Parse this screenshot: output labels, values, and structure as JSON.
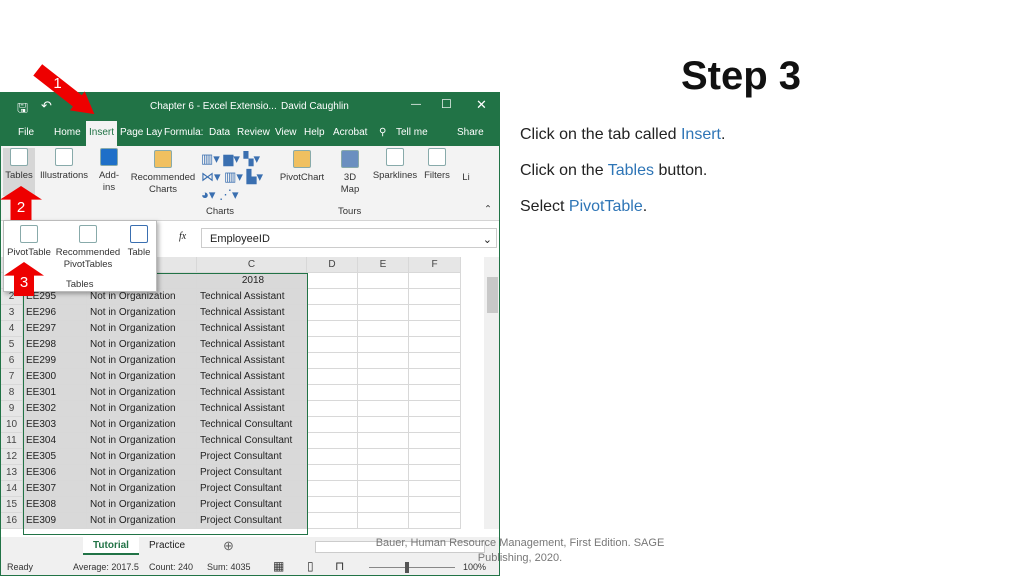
{
  "slide": {
    "title": "Step 3",
    "instructions": [
      {
        "pre": "Click on the tab called ",
        "hl": "Insert",
        "post": "."
      },
      {
        "pre": "Click on the ",
        "hl": "Tables",
        "post": " button."
      },
      {
        "pre": "Select ",
        "hl": "PivotTable",
        "post": "."
      }
    ],
    "citation": "Bauer, Human Resource Management, First Edition. SAGE Publishing, 2020.",
    "step_markers": [
      "1",
      "2",
      "3"
    ]
  },
  "excel": {
    "title": "Chapter 6 - Excel Extensio...",
    "user": "David Caughlin",
    "tabs": [
      "File",
      "Home",
      "Insert",
      "Page Lay",
      "Formula:",
      "Data",
      "Review",
      "View",
      "Help",
      "Acrobat",
      "Tell me",
      "Share"
    ],
    "ribbon": {
      "tables": "Tables",
      "illustrations": "Illustrations",
      "addins": "Add-\nins",
      "recommended_charts": "Recommended Charts",
      "pivotchart": "PivotChart",
      "map3d": "3D Map",
      "sparklines": "Sparklines",
      "filters": "Filters",
      "links": "Li",
      "group_charts": "Charts",
      "group_tours": "Tours"
    },
    "dropdown": {
      "pivottable": "PivotTable",
      "recommended": "Recommended PivotTables",
      "table": "Table",
      "group": "Tables"
    },
    "formula": {
      "fx": "fx",
      "value": "EmployeeID"
    },
    "columns": [
      "C",
      "D",
      "E",
      "F"
    ],
    "header_row": {
      "c": "2018"
    },
    "rows": [
      [
        "2",
        "EE295",
        "Not in Organization",
        "Technical Assistant"
      ],
      [
        "3",
        "EE296",
        "Not in Organization",
        "Technical Assistant"
      ],
      [
        "4",
        "EE297",
        "Not in Organization",
        "Technical Assistant"
      ],
      [
        "5",
        "EE298",
        "Not in Organization",
        "Technical Assistant"
      ],
      [
        "6",
        "EE299",
        "Not in Organization",
        "Technical Assistant"
      ],
      [
        "7",
        "EE300",
        "Not in Organization",
        "Technical Assistant"
      ],
      [
        "8",
        "EE301",
        "Not in Organization",
        "Technical Assistant"
      ],
      [
        "9",
        "EE302",
        "Not in Organization",
        "Technical Assistant"
      ],
      [
        "10",
        "EE303",
        "Not in Organization",
        "Technical Consultant"
      ],
      [
        "11",
        "EE304",
        "Not in Organization",
        "Technical Consultant"
      ],
      [
        "12",
        "EE305",
        "Not in Organization",
        "Project Consultant"
      ],
      [
        "13",
        "EE306",
        "Not in Organization",
        "Project Consultant"
      ],
      [
        "14",
        "EE307",
        "Not in Organization",
        "Project Consultant"
      ],
      [
        "15",
        "EE308",
        "Not in Organization",
        "Project Consultant"
      ],
      [
        "16",
        "EE309",
        "Not in Organization",
        "Project Consultant"
      ]
    ],
    "sheets": [
      "Tutorial",
      "Practice"
    ],
    "status": {
      "ready": "Ready",
      "average": "Average: 2017.5",
      "count": "Count: 240",
      "sum": "Sum: 4035",
      "zoom": "100%"
    },
    "accent": "#217346"
  }
}
